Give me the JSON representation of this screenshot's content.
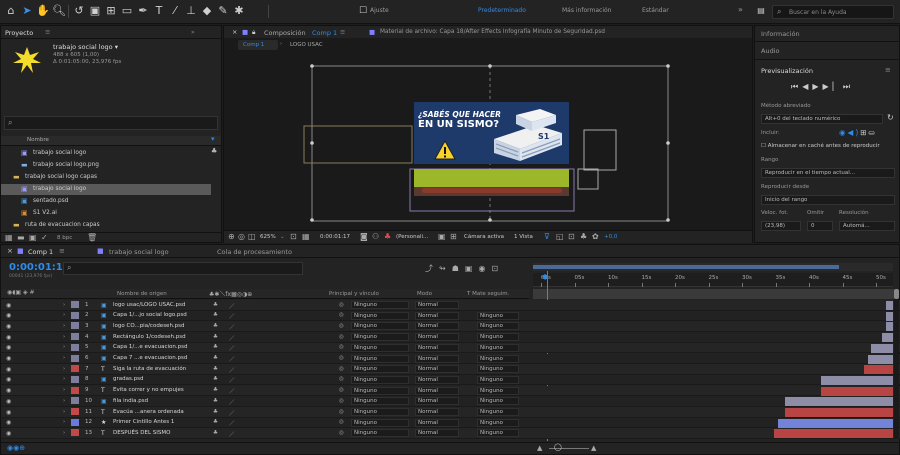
{
  "toolbar": {
    "workspace_items": [
      "Predeterminado",
      "Más información",
      "Estándar"
    ],
    "snap_label": "Ajuste",
    "search_placeholder": "Buscar en la Ayuda",
    "active_workspace_color": "#2d8ceb"
  },
  "project": {
    "tab_label": "Proyecto",
    "selected_name": "trabajo social logo ▾",
    "selected_size": "488 x 605 (1,00)",
    "selected_duration": "Δ 0:01:05:00, 23,976 fps",
    "column_name": "Nombre",
    "items": [
      {
        "name": "trabajo social logo",
        "icon": "comp-icon"
      },
      {
        "name": "trabajo social logo.png",
        "icon": "image-icon"
      },
      {
        "name": "trabajo social logo capas",
        "icon": "folder-icon"
      },
      {
        "name": "trabajo social logo",
        "icon": "comp-icon",
        "selected": true
      },
      {
        "name": "sentado.psd",
        "icon": "psd-icon"
      },
      {
        "name": "S1 V2.ai",
        "icon": "ai-icon"
      },
      {
        "name": "ruta de evacuacion capas",
        "icon": "folder-icon"
      }
    ],
    "bpc": "8 bpc"
  },
  "viewer": {
    "tab_label": "Composición",
    "comp_name": "Comp 1",
    "footage_label": "Material de archivo: Capa 18/After Effects Infografía Minuto de Seguridad.psd",
    "breadcrumb": [
      "Comp 1",
      "LOGO USAC"
    ],
    "headline_line1": "¿SABÉS QUE HACER",
    "headline_line2": "EN UN SISMO?",
    "building_label": "S1",
    "zoom": "625%",
    "timecode": "0:00:01:17",
    "resolution": "(Personali...",
    "camera": "Cámara activa",
    "views": "1 Vista",
    "exposure": "+0,0",
    "colors": {
      "poster_bg": "#1e3a6b",
      "green_band": "#9cb82a",
      "base_brown": "#8a3a2a"
    }
  },
  "preview": {
    "info_label": "Información",
    "audio_label": "Audio",
    "title": "Previsualización",
    "shortcut_label": "Método abreviado",
    "shortcut_value": "Alt+0 del teclado numérico",
    "include_label": "Incluir:",
    "cache_label": "Almacenar en caché antes de reproducir",
    "range_label": "Rango",
    "range_value": "Reproducir en el tiempo actual...",
    "play_from_label": "Reproducir desde",
    "play_from_value": "Inicio del rango",
    "fps_label": "Veloc. fot.",
    "skip_label": "Omitir",
    "res_label": "Resolución",
    "fps_value": "(23,98)",
    "skip_value": "0",
    "res_value": "Automá..."
  },
  "timeline": {
    "tabs": [
      "Comp 1",
      "trabajo social logo",
      "Cola de procesamiento"
    ],
    "current_time": "0:00:01:17",
    "frame_info": "00041 (23,976 fps)",
    "columns": {
      "name": "Nombre de origen",
      "parent": "Principal y vínculo",
      "mode": "Modo",
      "trkmat": "T  Mate seguim."
    },
    "ruler_ticks": [
      "00s",
      "05s",
      "10s",
      "15s",
      "20s",
      "25s",
      "30s",
      "35s",
      "40s",
      "45s",
      "50s"
    ],
    "layers": [
      {
        "num": "1",
        "name": "logo usac/LOGO USAC.psd",
        "color": "#7d7d9c",
        "type": "psd",
        "parent": "Ninguno",
        "mode": "Normal",
        "trk": "",
        "bar_start": 0.98,
        "bar_color": "#8d8da8"
      },
      {
        "num": "2",
        "name": "Capa 1/...jo social logo.psd",
        "color": "#7d7d9c",
        "type": "psd",
        "parent": "Ninguno",
        "mode": "Normal",
        "trk": "Ninguno",
        "bar_start": 0.98,
        "bar_color": "#8d8da8"
      },
      {
        "num": "3",
        "name": "logo CO...pia/codeseh.psd",
        "color": "#7d7d9c",
        "type": "psd",
        "parent": "Ninguno",
        "mode": "Normal",
        "trk": "Ninguno",
        "bar_start": 0.98,
        "bar_color": "#8d8da8"
      },
      {
        "num": "4",
        "name": "Rectángulo 1/codeseh.psd",
        "color": "#7d7d9c",
        "type": "psd",
        "parent": "Ninguno",
        "mode": "Normal",
        "trk": "Ninguno",
        "bar_start": 0.97,
        "bar_color": "#8d8da8"
      },
      {
        "num": "5",
        "name": "Capa 1/...e evacuacion.psd",
        "color": "#7d7d9c",
        "type": "psd",
        "parent": "Ninguno",
        "mode": "Normal",
        "trk": "Ninguno",
        "bar_start": 0.94,
        "bar_color": "#8d8da8"
      },
      {
        "num": "6",
        "name": "Capa 7 ...e evacuacion.psd",
        "color": "#7d7d9c",
        "type": "psd",
        "parent": "Ninguno",
        "mode": "Normal",
        "trk": "Ninguno",
        "bar_start": 0.93,
        "bar_color": "#8d8da8"
      },
      {
        "num": "7",
        "name": "Siga la ruta de evacuación",
        "color": "#c04a4a",
        "type": "text",
        "parent": "Ninguno",
        "mode": "Normal",
        "trk": "Ninguno",
        "bar_start": 0.92,
        "bar_color": "#b84444"
      },
      {
        "num": "8",
        "name": "gradas.psd",
        "color": "#7d7d9c",
        "type": "psd",
        "parent": "Ninguno",
        "mode": "Normal",
        "trk": "Ninguno",
        "bar_start": 0.8,
        "bar_color": "#8d8da8"
      },
      {
        "num": "9",
        "name": "Evita correr y no empujes",
        "color": "#c04a4a",
        "type": "text",
        "parent": "Ninguno",
        "mode": "Normal",
        "trk": "Ninguno",
        "bar_start": 0.8,
        "bar_color": "#b84444"
      },
      {
        "num": "10",
        "name": "fila india.psd",
        "color": "#7d7d9c",
        "type": "psd",
        "parent": "Ninguno",
        "mode": "Normal",
        "trk": "Ninguno",
        "bar_start": 0.7,
        "bar_color": "#8d8da8"
      },
      {
        "num": "11",
        "name": "Evacúa ...anera ordenada",
        "color": "#c04a4a",
        "type": "text",
        "parent": "Ninguno",
        "mode": "Normal",
        "trk": "Ninguno",
        "bar_start": 0.7,
        "bar_color": "#b84444"
      },
      {
        "num": "12",
        "name": "Primer Cintillo Antes 1",
        "color": "#6a7adc",
        "type": "shape",
        "parent": "Ninguno",
        "mode": "Normal",
        "trk": "Ninguno",
        "bar_start": 0.68,
        "bar_color": "#7283d8"
      },
      {
        "num": "13",
        "name": "DESPUÉS DEL SISMO",
        "color": "#c04a4a",
        "type": "text",
        "parent": "Ninguno",
        "mode": "Normal",
        "trk": "Ninguno",
        "bar_start": 0.67,
        "bar_color": "#b84444"
      }
    ]
  }
}
